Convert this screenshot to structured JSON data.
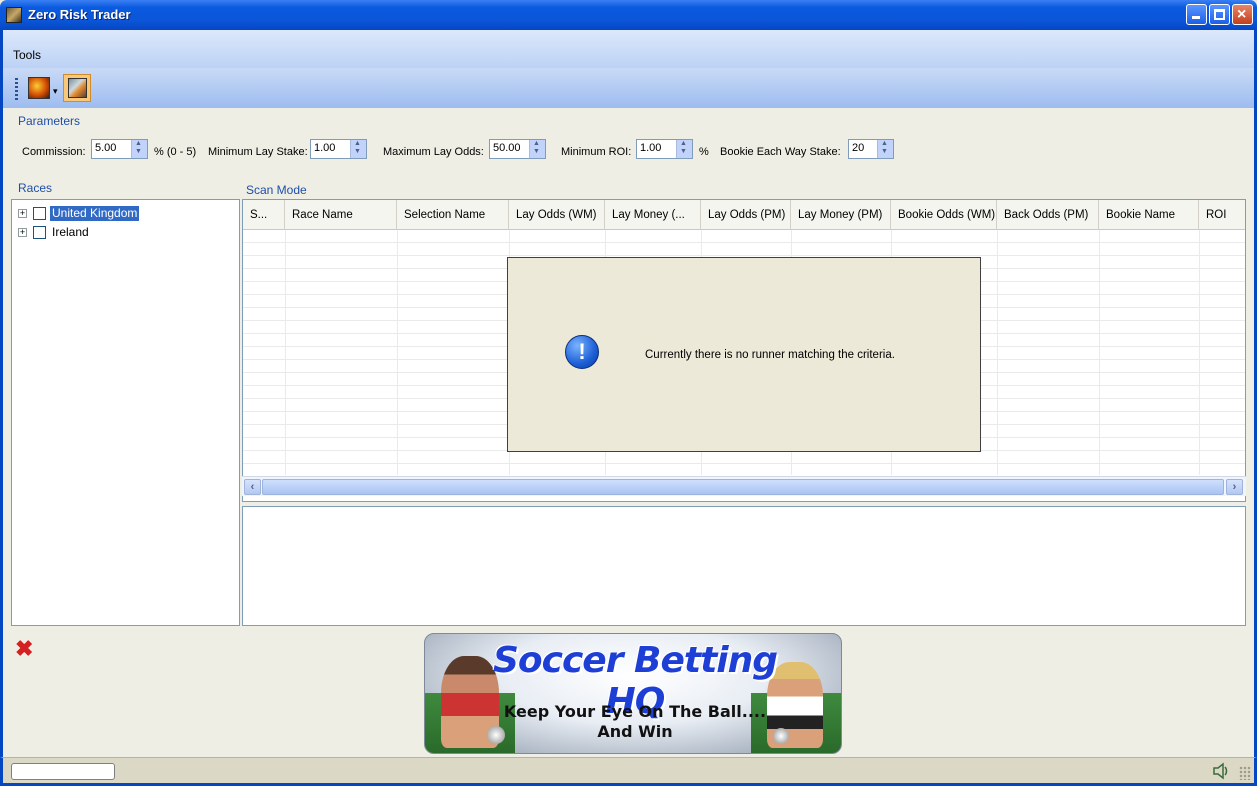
{
  "window": {
    "title": "Zero Risk Trader"
  },
  "menu": {
    "items": [
      "Tools"
    ]
  },
  "parameters": {
    "group_label": "Parameters",
    "commission_label": "Commission:",
    "commission_value": "5.00",
    "commission_hint": "% (0 - 5)",
    "min_lay_stake_label": "Minimum Lay Stake:",
    "min_lay_stake_value": "1.00",
    "max_lay_odds_label": "Maximum Lay Odds:",
    "max_lay_odds_value": "50.00",
    "min_roi_label": "Minimum ROI:",
    "min_roi_value": "1.00",
    "min_roi_unit": "%",
    "bookie_each_way_label": "Bookie Each Way Stake:",
    "bookie_each_way_value": "20"
  },
  "races": {
    "group_label": "Races",
    "items": [
      {
        "label": "United Kingdom",
        "selected": true
      },
      {
        "label": "Ireland",
        "selected": false
      }
    ]
  },
  "scan": {
    "group_label": "Scan Mode",
    "columns": [
      "S...",
      "Race Name",
      "Selection Name",
      "Lay Odds (WM)",
      "Lay Money (...",
      "Lay Odds (PM)",
      "Lay Money (PM)",
      "Bookie Odds (WM)",
      "Back Odds (PM)",
      "Bookie Name",
      "ROI"
    ],
    "message": "Currently there is no runner matching the criteria."
  },
  "banner": {
    "title": "Soccer Betting HQ",
    "line1": "Keep Your Eye On The Ball....",
    "line2": "And Win"
  },
  "icons": {
    "app": "app-icon",
    "info": "info-icon",
    "error": "error-icon",
    "speaker": "speaker-icon"
  },
  "colors": {
    "titlebar": "#0a5ae0",
    "selection": "#316ac5",
    "group_label": "#1f4ea8"
  }
}
